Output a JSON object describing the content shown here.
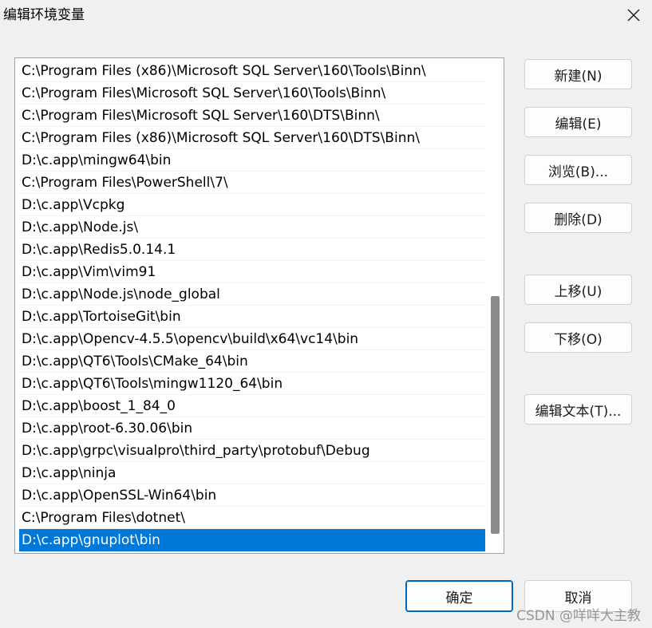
{
  "window": {
    "title": "编辑环境变量",
    "close_icon": "close-icon"
  },
  "path_list": {
    "items": [
      "C:\\Program Files (x86)\\Microsoft SQL Server\\160\\Tools\\Binn\\",
      "C:\\Program Files\\Microsoft SQL Server\\160\\Tools\\Binn\\",
      "C:\\Program Files\\Microsoft SQL Server\\160\\DTS\\Binn\\",
      "C:\\Program Files (x86)\\Microsoft SQL Server\\160\\DTS\\Binn\\",
      "D:\\c.app\\mingw64\\bin",
      "C:\\Program Files\\PowerShell\\7\\",
      "D:\\c.app\\Vcpkg",
      "D:\\c.app\\Node.js\\",
      "D:\\c.app\\Redis5.0.14.1",
      "D:\\c.app\\Vim\\vim91",
      "D:\\c.app\\Node.js\\node_global",
      "D:\\c.app\\TortoiseGit\\bin",
      "D:\\c.app\\Opencv-4.5.5\\opencv\\build\\x64\\vc14\\bin",
      "D:\\c.app\\QT6\\Tools\\CMake_64\\bin",
      "D:\\c.app\\QT6\\Tools\\mingw1120_64\\bin",
      "D:\\c.app\\boost_1_84_0",
      "D:\\c.app\\root-6.30.06\\bin",
      "D:\\c.app\\grpc\\visualpro\\third_party\\protobuf\\Debug",
      "D:\\c.app\\ninja",
      "D:\\c.app\\OpenSSL-Win64\\bin",
      "C:\\Program Files\\dotnet\\",
      "D:\\c.app\\gnuplot\\bin"
    ],
    "selected_item": "D:\\c.app\\gnuplot\\bin",
    "selection_color": "#0078d7"
  },
  "side_buttons": {
    "new": "新建(N)",
    "edit": "编辑(E)",
    "browse": "浏览(B)...",
    "delete": "删除(D)",
    "move_up": "上移(U)",
    "move_down": "下移(O)",
    "edit_text": "编辑文本(T)..."
  },
  "bottom_buttons": {
    "ok": "确定",
    "cancel": "取消"
  },
  "watermark": "CSDN @咩咩大主教"
}
